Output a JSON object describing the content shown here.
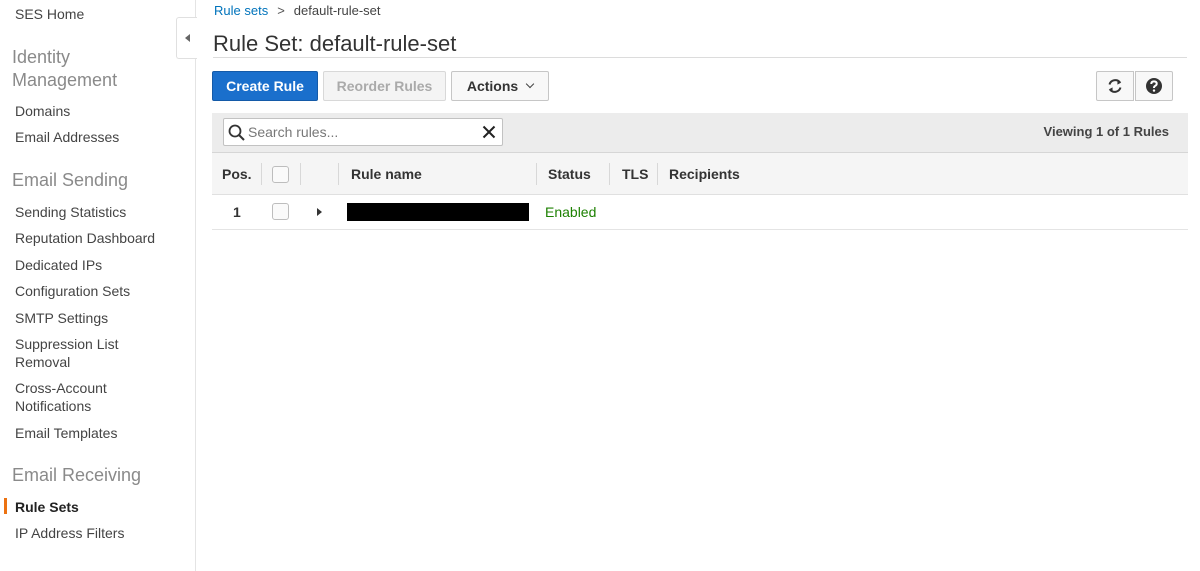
{
  "sidebar": {
    "top_link": "SES Home",
    "sections": [
      {
        "title": "Identity Management",
        "items": [
          "Domains",
          "Email Addresses"
        ]
      },
      {
        "title": "Email Sending",
        "items": [
          "Sending Statistics",
          "Reputation Dashboard",
          "Dedicated IPs",
          "Configuration Sets",
          "SMTP Settings",
          "Suppression List Removal",
          "Cross-Account Notifications",
          "Email Templates"
        ]
      },
      {
        "title": "Email Receiving",
        "items": [
          "Rule Sets",
          "IP Address Filters"
        ]
      }
    ],
    "active_item": "Rule Sets",
    "active_color": "#ec7211"
  },
  "breadcrumb": {
    "parent": "Rule sets",
    "separator": ">",
    "current": "default-rule-set"
  },
  "page": {
    "title": "Rule Set: default-rule-set"
  },
  "toolbar": {
    "create_label": "Create Rule",
    "reorder_label": "Reorder Rules",
    "actions_label": "Actions",
    "refresh_icon": "refresh-icon",
    "help_icon": "help-icon",
    "primary_color": "#1a6fcc"
  },
  "search": {
    "placeholder": "Search rules...",
    "value": ""
  },
  "table": {
    "viewing": "Viewing 1 of 1 Rules",
    "columns": [
      "Pos.",
      "Rule name",
      "Status",
      "TLS",
      "Recipients"
    ],
    "rows": [
      {
        "pos": "1",
        "rule_name": "",
        "status": "Enabled",
        "tls": "",
        "recipients": ""
      }
    ],
    "status_color": "#1d8102"
  }
}
